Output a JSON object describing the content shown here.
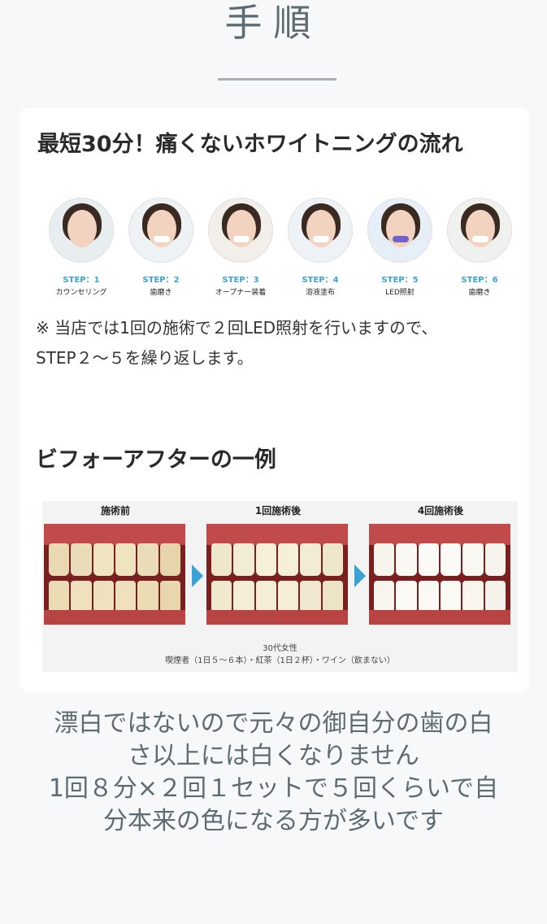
{
  "page_title": "手順",
  "flow": {
    "heading": "最短30分！痛くないホワイトニングの流れ",
    "steps": [
      {
        "label": "STEP：1",
        "name": "カウンセリング"
      },
      {
        "label": "STEP：2",
        "name": "歯磨き"
      },
      {
        "label": "STEP：3",
        "name": "オープナー装着"
      },
      {
        "label": "STEP：4",
        "name": "溶液塗布"
      },
      {
        "label": "STEP：5",
        "name": "LED照射"
      },
      {
        "label": "STEP：6",
        "name": "歯磨き"
      }
    ],
    "note_line1": "※ 当店では1回の施術で２回LED照射を行いますので、",
    "note_line2": "STEP２〜５を繰り返します。"
  },
  "before_after": {
    "heading": "ビフォーアフターの一例",
    "labels": [
      "施術前",
      "1回施術後",
      "4回施術後"
    ],
    "caption_line1": "30代女性",
    "caption_line2": "喫煙者（1日５〜６本）・紅茶（1日２杯）・ワイン（飲まない）"
  },
  "bottom": {
    "line1": "漂白ではないので元々の御自分の歯の白",
    "line2": "さ以上には白くなりません",
    "line3": "1回８分×２回１セットで５回くらいで自",
    "line4": "分本来の色になる方が多いです"
  },
  "colors": {
    "accent": "#3aa3d6",
    "title_gray": "#5f6b73"
  }
}
